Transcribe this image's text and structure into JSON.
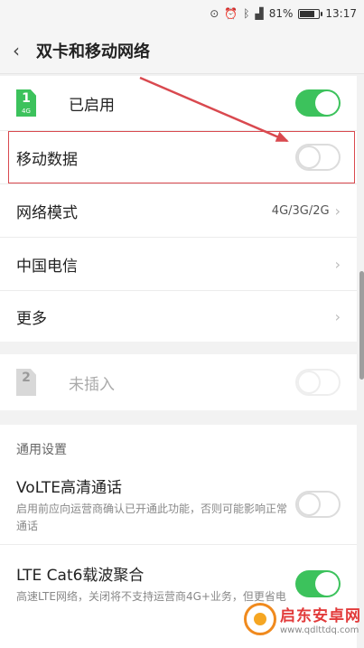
{
  "status_bar": {
    "battery_text": "81%",
    "time": "13:17",
    "icons": [
      "location-icon",
      "alarm-icon",
      "bluetooth-icon",
      "signal-icon",
      "battery-icon"
    ]
  },
  "header": {
    "title": "双卡和移动网络",
    "back_icon": "chevron-left-icon"
  },
  "sim1": {
    "slot_number": "1",
    "network_type": "4G",
    "status_label": "已启用",
    "enabled": true
  },
  "mobile_data": {
    "label": "移动数据",
    "enabled": false
  },
  "network_mode": {
    "label": "网络模式",
    "value": "4G/3G/2G"
  },
  "carrier": {
    "label": "中国电信"
  },
  "more": {
    "label": "更多"
  },
  "sim2": {
    "slot_number": "2",
    "status_label": "未插入",
    "enabled": false
  },
  "general_settings": {
    "section_title": "通用设置",
    "volte": {
      "title": "VoLTE高清通话",
      "description": "启用前应向运营商确认已开通此功能，否则可能影响正常通话",
      "enabled": false
    },
    "lte_cat6": {
      "title": "LTE Cat6载波聚合",
      "description": "高速LTE网络，关闭将不支持运营商4G+业务，但更省电",
      "enabled": true
    }
  },
  "watermark": {
    "name": "启东安卓网",
    "url": "www.qdlttdq.com"
  },
  "colors": {
    "accent_green": "#3cc25c",
    "highlight_red": "#d9494f"
  }
}
